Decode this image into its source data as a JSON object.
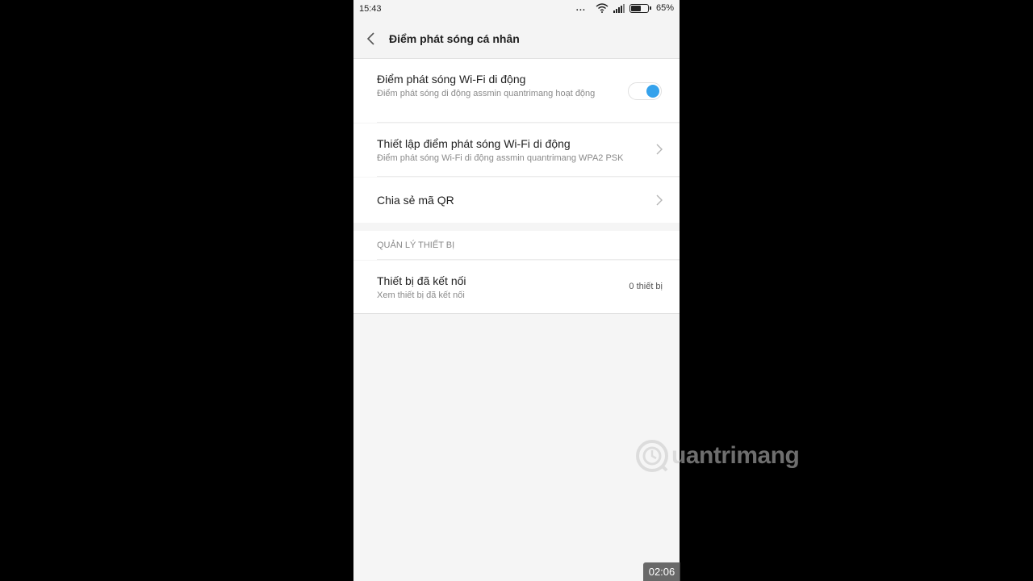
{
  "status_bar": {
    "time": "15:43",
    "dots": "...",
    "battery_percent": "65%",
    "battery_level": 0.65,
    "icons": [
      "wifi-icon",
      "signal-icon",
      "battery-icon"
    ]
  },
  "appbar": {
    "title": "Điểm phát sóng cá nhân",
    "back_icon": "chevron-left-icon"
  },
  "settings": {
    "hotspot": {
      "label": "Điểm phát sóng Wi-Fi di động",
      "subtitle": "Điểm phát sóng di động assmin quantrimang hoạt động",
      "enabled": true
    },
    "setup": {
      "label": "Thiết lập điểm phát sóng Wi-Fi di động",
      "subtitle": "Điểm phát sóng Wi-Fi di động assmin quantrimang WPA2 PSK"
    },
    "share_qr": {
      "label": "Chia sẻ mã QR"
    }
  },
  "device_section": {
    "header": "QUẢN LÝ THIẾT BỊ",
    "connected": {
      "label": "Thiết bị đã kết nối",
      "subtitle": "Xem thiết bị đã kết nối",
      "value": "0 thiết bị"
    }
  },
  "overlay": {
    "watermark_text": "uantrimang",
    "video_time": "02:06"
  },
  "colors": {
    "accent": "#35a2ec",
    "background": "#f5f5f5",
    "outer": "#000000"
  }
}
